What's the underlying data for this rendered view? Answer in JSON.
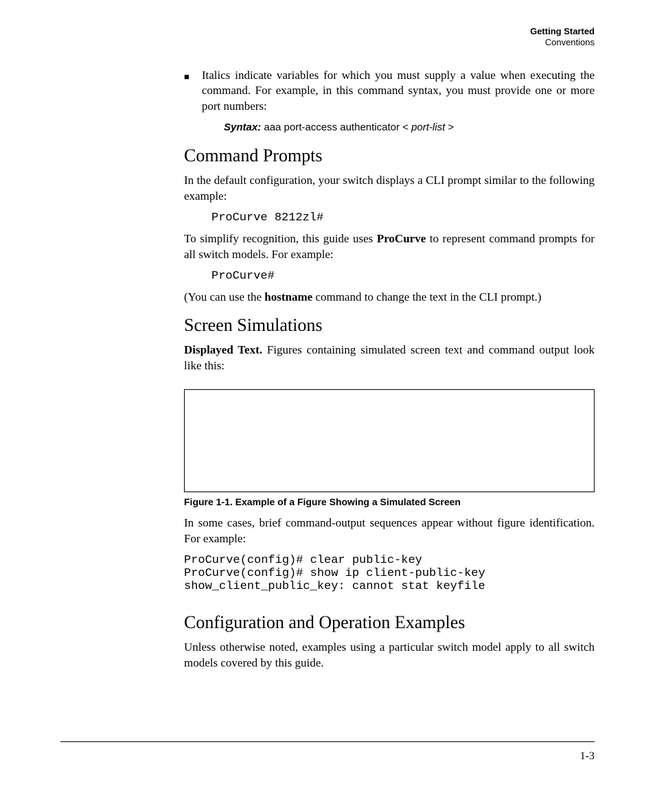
{
  "runningHead": {
    "chapter": "Getting Started",
    "section": "Conventions"
  },
  "bullet": {
    "text": "Italics indicate variables for which you must supply a value when executing the command. For example, in this command syntax, you must provide one or more port numbers:"
  },
  "syntax": {
    "label": "Syntax:",
    "cmd": " aaa port-access authenticator < ",
    "var": "port-list",
    "tail": " >"
  },
  "cmdPrompts": {
    "heading": "Command Prompts",
    "p1": "In the default configuration, your switch displays a CLI prompt similar to the following example:",
    "code1": "ProCurve 8212zl#",
    "p2a": "To simplify recognition, this guide uses ",
    "p2bold": "ProCurve",
    "p2b": " to represent command prompts for all switch models. For example:",
    "code2": "ProCurve#",
    "p3a": "(You can use the ",
    "p3bold": "hostname",
    "p3b": " command to change the text in the CLI prompt.)"
  },
  "screenSim": {
    "heading": "Screen Simulations",
    "leadBold": "Displayed Text.",
    "leadRest": "  Figures containing simulated screen text and command output look like this:",
    "figCaption": "Figure 1-1.   Example of a Figure Showing a Simulated Screen",
    "p2": "In some cases, brief command-output sequences appear without figure identification. For example:",
    "code": "ProCurve(config)# clear public-key\nProCurve(config)# show ip client-public-key\nshow_client_public_key: cannot stat keyfile"
  },
  "configOp": {
    "heading": "Configuration and Operation Examples",
    "p1": "Unless otherwise noted, examples using a particular switch model apply to all switch models covered by this guide."
  },
  "pageNumber": "1-3"
}
